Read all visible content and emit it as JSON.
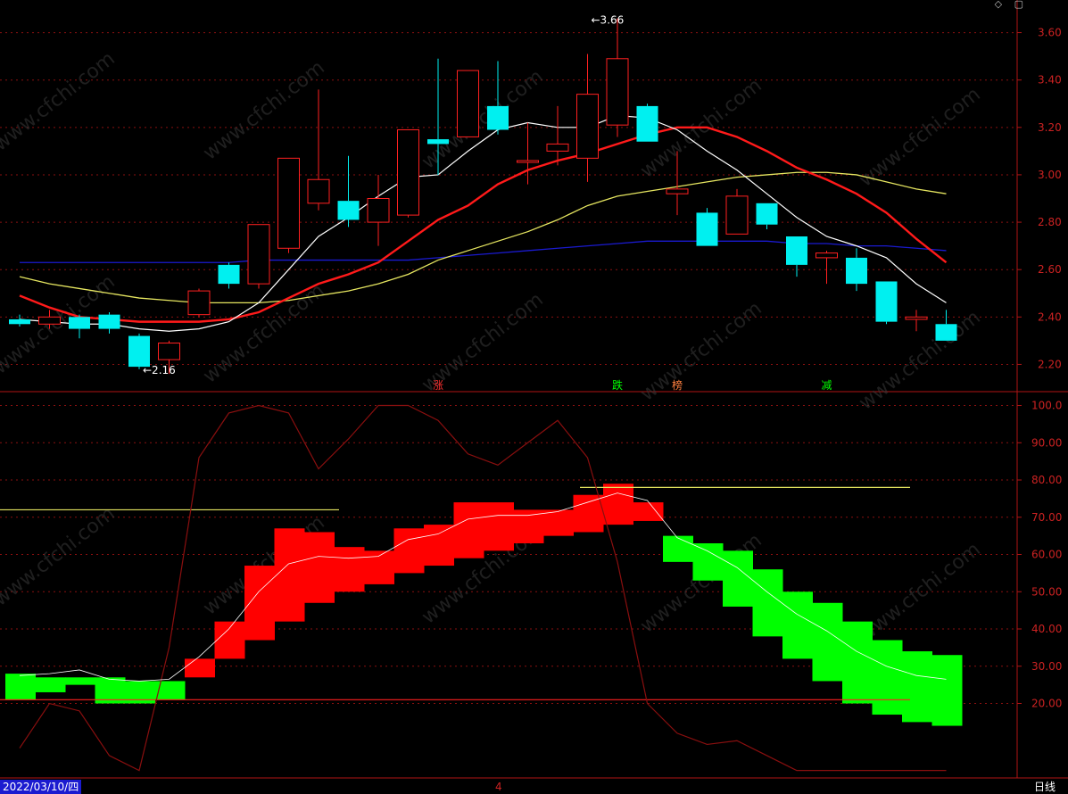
{
  "footer": {
    "date": "2022/03/10/四",
    "cursor_value": "4",
    "period": "日线"
  },
  "top_icons": [
    {
      "name": "diamond-icon",
      "glyph": "◇"
    },
    {
      "name": "square-icon",
      "glyph": "▢"
    }
  ],
  "colors": {
    "up": "#ff2020",
    "down": "#00f0f0",
    "ma5": "#ffffff",
    "ma10": "#ff1a1a",
    "ma20": "#e6e660",
    "ma60": "#1a1ad0",
    "band_up": "#ff0000",
    "band_down": "#00ff00",
    "grid": "#8a1010"
  },
  "watermark": "www.cfchi.com",
  "chart_data": [
    {
      "type": "candlestick",
      "y_ticks": [
        "3.60",
        "3.40",
        "3.20",
        "3.00",
        "2.80",
        "2.60",
        "2.40",
        "2.20"
      ],
      "ylim": [
        2.1,
        3.7
      ],
      "extremes": [
        {
          "label": "3.66",
          "value": 3.66,
          "index": 19
        },
        {
          "label": "2.16",
          "value": 2.16,
          "index": 4
        }
      ],
      "candles": [
        {
          "o": 2.39,
          "h": 2.41,
          "l": 2.36,
          "c": 2.37
        },
        {
          "o": 2.37,
          "h": 2.43,
          "l": 2.35,
          "c": 2.4
        },
        {
          "o": 2.4,
          "h": 2.41,
          "l": 2.31,
          "c": 2.35
        },
        {
          "o": 2.41,
          "h": 2.42,
          "l": 2.33,
          "c": 2.35
        },
        {
          "o": 2.32,
          "h": 2.33,
          "l": 2.18,
          "c": 2.19
        },
        {
          "o": 2.22,
          "h": 2.3,
          "l": 2.16,
          "c": 2.29
        },
        {
          "o": 2.41,
          "h": 2.52,
          "l": 2.4,
          "c": 2.51
        },
        {
          "o": 2.62,
          "h": 2.63,
          "l": 2.52,
          "c": 2.54
        },
        {
          "o": 2.54,
          "h": 2.79,
          "l": 2.52,
          "c": 2.79
        },
        {
          "o": 2.69,
          "h": 3.07,
          "l": 2.67,
          "c": 3.07
        },
        {
          "o": 2.88,
          "h": 3.36,
          "l": 2.85,
          "c": 2.98
        },
        {
          "o": 2.89,
          "h": 3.08,
          "l": 2.78,
          "c": 2.81
        },
        {
          "o": 2.8,
          "h": 3.0,
          "l": 2.7,
          "c": 2.9
        },
        {
          "o": 2.83,
          "h": 3.19,
          "l": 2.82,
          "c": 3.19
        },
        {
          "o": 3.15,
          "h": 3.49,
          "l": 3.0,
          "c": 3.13
        },
        {
          "o": 3.16,
          "h": 3.44,
          "l": 3.16,
          "c": 3.44
        },
        {
          "o": 3.29,
          "h": 3.48,
          "l": 3.17,
          "c": 3.19
        },
        {
          "o": 3.06,
          "h": 3.22,
          "l": 2.96,
          "c": 3.06
        },
        {
          "o": 3.1,
          "h": 3.29,
          "l": 3.04,
          "c": 3.13
        },
        {
          "o": 3.07,
          "h": 3.51,
          "l": 2.97,
          "c": 3.34
        },
        {
          "o": 3.21,
          "h": 3.66,
          "l": 3.16,
          "c": 3.49
        },
        {
          "o": 3.29,
          "h": 3.3,
          "l": 3.14,
          "c": 3.14
        },
        {
          "o": 2.92,
          "h": 3.1,
          "l": 2.83,
          "c": 2.94
        },
        {
          "o": 2.84,
          "h": 2.86,
          "l": 2.7,
          "c": 2.7
        },
        {
          "o": 2.75,
          "h": 2.94,
          "l": 2.75,
          "c": 2.91
        },
        {
          "o": 2.88,
          "h": 2.88,
          "l": 2.77,
          "c": 2.79
        },
        {
          "o": 2.74,
          "h": 2.74,
          "l": 2.57,
          "c": 2.62
        },
        {
          "o": 2.65,
          "h": 2.68,
          "l": 2.54,
          "c": 2.67
        },
        {
          "o": 2.65,
          "h": 2.69,
          "l": 2.51,
          "c": 2.54
        },
        {
          "o": 2.55,
          "h": 2.55,
          "l": 2.37,
          "c": 2.38
        },
        {
          "o": 2.39,
          "h": 2.43,
          "l": 2.34,
          "c": 2.4
        },
        {
          "o": 2.37,
          "h": 2.43,
          "l": 2.3,
          "c": 2.3
        }
      ],
      "ma5": [
        2.39,
        2.38,
        2.37,
        2.37,
        2.35,
        2.34,
        2.35,
        2.38,
        2.46,
        2.6,
        2.74,
        2.82,
        2.91,
        2.99,
        3.0,
        3.1,
        3.19,
        3.22,
        3.2,
        3.2,
        3.25,
        3.24,
        3.19,
        3.1,
        3.02,
        2.92,
        2.82,
        2.74,
        2.7,
        2.65,
        2.54,
        2.46
      ],
      "ma10": [
        2.49,
        2.44,
        2.4,
        2.39,
        2.38,
        2.38,
        2.38,
        2.39,
        2.42,
        2.48,
        2.54,
        2.58,
        2.63,
        2.72,
        2.81,
        2.87,
        2.96,
        3.02,
        3.06,
        3.09,
        3.13,
        3.17,
        3.2,
        3.2,
        3.16,
        3.1,
        3.03,
        2.98,
        2.92,
        2.84,
        2.73,
        2.63
      ],
      "ma20": [
        2.57,
        2.54,
        2.52,
        2.5,
        2.48,
        2.47,
        2.46,
        2.46,
        2.46,
        2.47,
        2.49,
        2.51,
        2.54,
        2.58,
        2.64,
        2.68,
        2.72,
        2.76,
        2.81,
        2.87,
        2.91,
        2.93,
        2.95,
        2.97,
        2.99,
        3.0,
        3.01,
        3.01,
        3.0,
        2.97,
        2.94,
        2.92
      ],
      "ma60": [
        2.63,
        2.63,
        2.63,
        2.63,
        2.63,
        2.63,
        2.63,
        2.63,
        2.64,
        2.64,
        2.64,
        2.64,
        2.64,
        2.64,
        2.65,
        2.66,
        2.67,
        2.68,
        2.69,
        2.7,
        2.71,
        2.72,
        2.72,
        2.72,
        2.72,
        2.72,
        2.71,
        2.71,
        2.7,
        2.7,
        2.69,
        2.68
      ],
      "signals": [
        {
          "index": 14,
          "label": "涨",
          "color": "#ff3030"
        },
        {
          "index": 20,
          "label": "跌",
          "color": "#00ff00"
        },
        {
          "index": 22,
          "label": "榜",
          "color": "#ff8040"
        },
        {
          "index": 27,
          "label": "减",
          "color": "#00ff00"
        }
      ]
    },
    {
      "type": "indicator",
      "y_ticks": [
        "100.0",
        "90.00",
        "80.00",
        "70.00",
        "60.00",
        "50.00",
        "40.00",
        "30.00",
        "20.00"
      ],
      "ylim": [
        0,
        103
      ],
      "blocks": [
        {
          "top": 28,
          "bottom": 21,
          "color": "down"
        },
        {
          "top": 27,
          "bottom": 23,
          "color": "down"
        },
        {
          "top": 27,
          "bottom": 25,
          "color": "down"
        },
        {
          "top": 27,
          "bottom": 20,
          "color": "down"
        },
        {
          "top": 26,
          "bottom": 20,
          "color": "down"
        },
        {
          "top": 26,
          "bottom": 21,
          "color": "down"
        },
        {
          "top": 32,
          "bottom": 27,
          "color": "up"
        },
        {
          "top": 42,
          "bottom": 32,
          "color": "up"
        },
        {
          "top": 57,
          "bottom": 37,
          "color": "up"
        },
        {
          "top": 67,
          "bottom": 42,
          "color": "up"
        },
        {
          "top": 66,
          "bottom": 47,
          "color": "up"
        },
        {
          "top": 62,
          "bottom": 50,
          "color": "up"
        },
        {
          "top": 61,
          "bottom": 52,
          "color": "up"
        },
        {
          "top": 67,
          "bottom": 55,
          "color": "up"
        },
        {
          "top": 68,
          "bottom": 57,
          "color": "up"
        },
        {
          "top": 74,
          "bottom": 59,
          "color": "up"
        },
        {
          "top": 74,
          "bottom": 61,
          "color": "up"
        },
        {
          "top": 72,
          "bottom": 63,
          "color": "up"
        },
        {
          "top": 72,
          "bottom": 65,
          "color": "up"
        },
        {
          "top": 76,
          "bottom": 66,
          "color": "up"
        },
        {
          "top": 79,
          "bottom": 68,
          "color": "up"
        },
        {
          "top": 74,
          "bottom": 69,
          "color": "up"
        },
        {
          "top": 65,
          "bottom": 58,
          "color": "down"
        },
        {
          "top": 63,
          "bottom": 53,
          "color": "down"
        },
        {
          "top": 61,
          "bottom": 46,
          "color": "down"
        },
        {
          "top": 56,
          "bottom": 38,
          "color": "down"
        },
        {
          "top": 50,
          "bottom": 32,
          "color": "down"
        },
        {
          "top": 47,
          "bottom": 26,
          "color": "down"
        },
        {
          "top": 42,
          "bottom": 20,
          "color": "down"
        },
        {
          "top": 37,
          "bottom": 17,
          "color": "down"
        },
        {
          "top": 34,
          "bottom": 15,
          "color": "down"
        },
        {
          "top": 33,
          "bottom": 14,
          "color": "down"
        }
      ],
      "kline": [
        8,
        20,
        18,
        6,
        2,
        35,
        86,
        98,
        100,
        98,
        83,
        91,
        100,
        100,
        96,
        87,
        84,
        90,
        96,
        86,
        58,
        20,
        12,
        9,
        10,
        6,
        2,
        2,
        2,
        2,
        2,
        2
      ],
      "upper_line": 78,
      "lower_line": 21
    }
  ]
}
